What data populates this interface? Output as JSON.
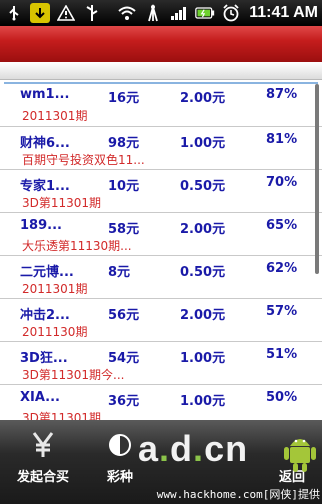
{
  "status_bar": {
    "time": "11:41 AM",
    "icons": [
      "usb-icon",
      "app-download-icon",
      "warning-icon",
      "usb-debug-icon",
      "wifi-icon",
      "signal-tower-icon",
      "signal-bars-icon",
      "battery-icon",
      "alarm-icon"
    ]
  },
  "list": {
    "rows": [
      {
        "name": "wm1...",
        "price": "16元",
        "rate": "2.00元",
        "pct": "87%",
        "desc": "2011301期"
      },
      {
        "name": "财神6...",
        "price": "98元",
        "rate": "1.00元",
        "pct": "81%",
        "desc": "百期守号投资双色11..."
      },
      {
        "name": "专家1...",
        "price": "10元",
        "rate": "0.50元",
        "pct": "70%",
        "desc": "3D第11301期"
      },
      {
        "name": "189...",
        "price": "58元",
        "rate": "2.00元",
        "pct": "65%",
        "desc": "大乐透第11130期..."
      },
      {
        "name": "二元博...",
        "price": "8元",
        "rate": "0.50元",
        "pct": "62%",
        "desc": "2011301期"
      },
      {
        "name": "冲击2...",
        "price": "56元",
        "rate": "2.00元",
        "pct": "57%",
        "desc": "2011130期"
      },
      {
        "name": "3D狂...",
        "price": "54元",
        "rate": "1.00元",
        "pct": "51%",
        "desc": "3D第11301期今..."
      },
      {
        "name": "XIA...",
        "price": "36元",
        "rate": "1.00元",
        "pct": "50%",
        "desc": "3D第11301期"
      }
    ]
  },
  "bottom_bar": {
    "tabs": [
      {
        "label": "发起合买",
        "icon": "yen-icon"
      },
      {
        "label": "彩种",
        "icon": "lottery-type-icon"
      },
      {
        "label": "返回",
        "icon": "back-icon"
      }
    ]
  },
  "watermark": {
    "logo": "a.d.cn",
    "text": "www.hackhome.com[网侠]提供"
  },
  "colors": {
    "title_red": "#c51d1d",
    "name_blue": "#1a1aa8",
    "desc_red": "#d22a2a"
  }
}
